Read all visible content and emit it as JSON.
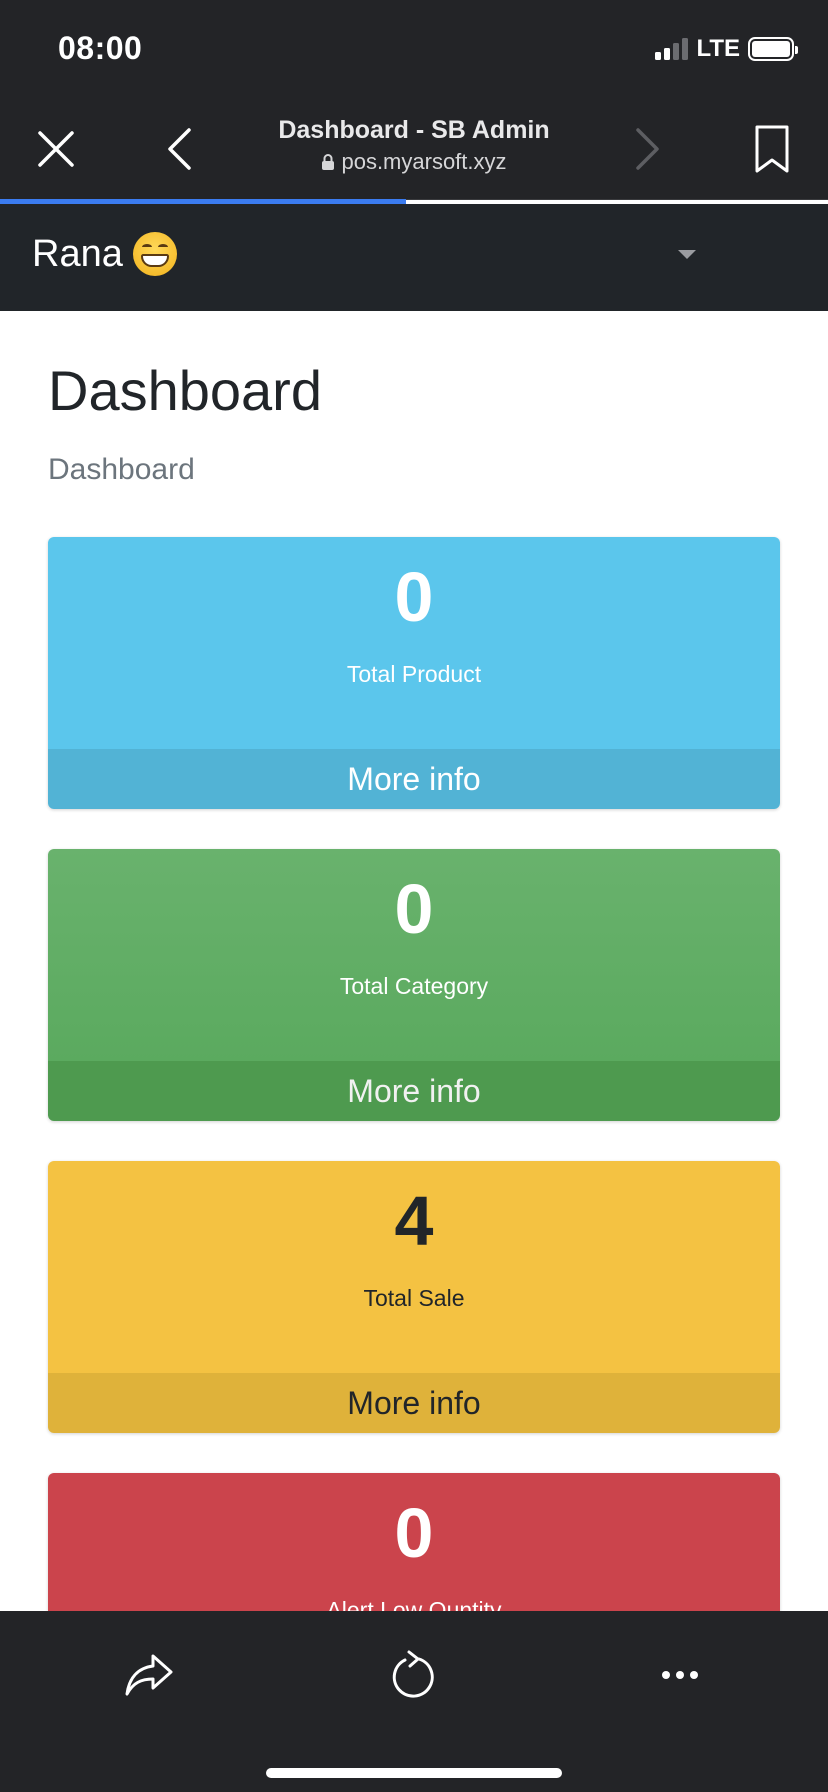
{
  "status_bar": {
    "time": "08:00",
    "network": "LTE"
  },
  "browser": {
    "page_title": "Dashboard - SB Admin",
    "url": "pos.myarsoft.xyz",
    "load_progress": 0.49,
    "icons": {
      "close": "close-icon",
      "back": "chevron-left-icon",
      "forward": "chevron-right-icon",
      "bookmark": "bookmark-icon",
      "lock": "lock-icon",
      "share": "share-icon",
      "reload": "reload-icon",
      "more": "more-icon"
    },
    "accent_color": "#3b7cf0"
  },
  "navbar": {
    "user_name": "Rana",
    "user_emoji": "grinning-face-emoji"
  },
  "main": {
    "heading": "Dashboard",
    "breadcrumb": "Dashboard"
  },
  "cards": [
    {
      "value": "0",
      "label": "Total Product",
      "footer": "More info",
      "color": "#5bc6ec"
    },
    {
      "value": "0",
      "label": "Total Category",
      "footer": "More info",
      "color": "#5fae62"
    },
    {
      "value": "4",
      "label": "Total Sale",
      "footer": "More info",
      "color": "#f4c242"
    },
    {
      "value": "0",
      "label": "Alert Low Quntity",
      "color": "#cb444c"
    }
  ]
}
